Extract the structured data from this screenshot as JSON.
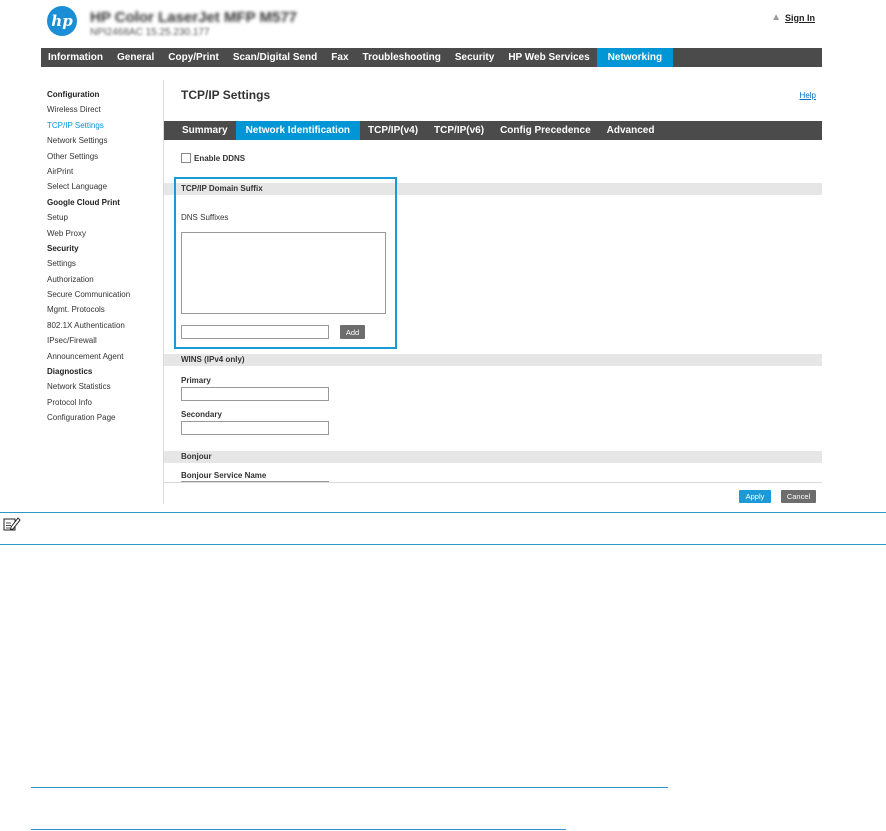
{
  "header": {
    "logo_text": "hp",
    "device_name": "HP Color LaserJet MFP M577",
    "device_sub": "NPI2468AC   15.25.230.177",
    "signin_label": "Sign In"
  },
  "top_nav": {
    "tabs": [
      {
        "label": "Information"
      },
      {
        "label": "General"
      },
      {
        "label": "Copy/Print"
      },
      {
        "label": "Scan/Digital Send"
      },
      {
        "label": "Fax"
      },
      {
        "label": "Troubleshooting"
      },
      {
        "label": "Security"
      },
      {
        "label": "HP Web Services"
      },
      {
        "label": "Networking",
        "active": true
      }
    ]
  },
  "sidebar": {
    "items": [
      {
        "label": "Configuration",
        "type": "head"
      },
      {
        "label": "Wireless Direct"
      },
      {
        "label": "TCP/IP Settings",
        "active": true
      },
      {
        "label": "Network Settings"
      },
      {
        "label": "Other Settings"
      },
      {
        "label": "AirPrint"
      },
      {
        "label": "Select Language"
      },
      {
        "label": "Google Cloud Print",
        "type": "head"
      },
      {
        "label": "Setup"
      },
      {
        "label": "Web Proxy"
      },
      {
        "label": "Security",
        "type": "head"
      },
      {
        "label": "Settings"
      },
      {
        "label": "Authorization"
      },
      {
        "label": "Secure Communication"
      },
      {
        "label": "Mgmt. Protocols"
      },
      {
        "label": "802.1X Authentication"
      },
      {
        "label": "IPsec/Firewall"
      },
      {
        "label": "Announcement Agent"
      },
      {
        "label": "Diagnostics",
        "type": "head"
      },
      {
        "label": "Network Statistics"
      },
      {
        "label": "Protocol Info"
      },
      {
        "label": "Configuration Page"
      }
    ]
  },
  "main": {
    "title": "TCP/IP Settings",
    "help_label": "Help",
    "sub_tabs": [
      {
        "label": "Summary"
      },
      {
        "label": "Network Identification",
        "active": true
      },
      {
        "label": "TCP/IP(v4)"
      },
      {
        "label": "TCP/IP(v6)"
      },
      {
        "label": "Config Precedence"
      },
      {
        "label": "Advanced"
      }
    ],
    "enable_ddns_label": "Enable DDNS",
    "enable_ddns_checked": false,
    "domain_suffix": {
      "section_title": "TCP/IP Domain Suffix",
      "dns_suffixes_label": "DNS Suffixes",
      "suffixes": [],
      "new_suffix_value": "",
      "add_label": "Add"
    },
    "wins": {
      "section_title": "WINS (IPv4 only)",
      "primary_label": "Primary",
      "primary_value": "",
      "secondary_label": "Secondary",
      "secondary_value": ""
    },
    "bonjour": {
      "section_title": "Bonjour",
      "service_name_label": "Bonjour Service Name"
    },
    "apply_label": "Apply",
    "cancel_label": "Cancel"
  },
  "colors": {
    "accent": "#0096d6",
    "nav_bg": "#4b4b4b",
    "section_bg": "#e6e6e6",
    "highlight": "#1a9ad6"
  },
  "icons": {
    "logo": "hp-logo",
    "signin": "home-icon",
    "note": "note-pencil-icon"
  }
}
